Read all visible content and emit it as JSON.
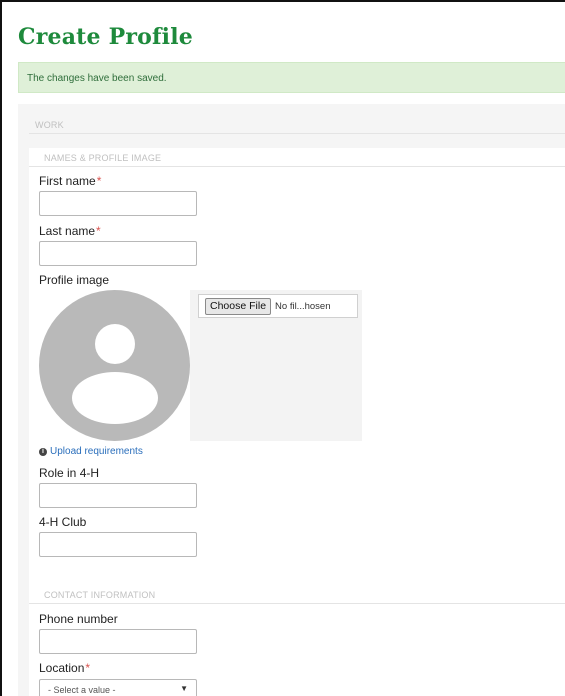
{
  "header": {
    "title": "Create Profile"
  },
  "status_message": "The changes have been saved.",
  "sections": {
    "work": "WORK",
    "names": "NAMES & PROFILE IMAGE",
    "contact": "CONTACT INFORMATION"
  },
  "fields": {
    "first_name": {
      "label": "First name",
      "required_mark": "*",
      "value": ""
    },
    "last_name": {
      "label": "Last name",
      "required_mark": "*",
      "value": ""
    },
    "profile_image": {
      "label": "Profile image",
      "choose_button": "Choose File",
      "file_status": "No fil...hosen",
      "upload_requirements": "Upload requirements",
      "info_icon": "info-icon"
    },
    "role": {
      "label": "Role in 4-H",
      "value": ""
    },
    "club": {
      "label": "4-H Club",
      "value": ""
    },
    "phone": {
      "label": "Phone number",
      "value": ""
    },
    "location": {
      "label": "Location",
      "required_mark": "*",
      "selected": "- Select a value -"
    }
  },
  "colors": {
    "title_green": "#1e8a3c",
    "status_bg": "#dff0d8",
    "required_red": "#d9534f",
    "link_blue": "#2a6ebb"
  }
}
